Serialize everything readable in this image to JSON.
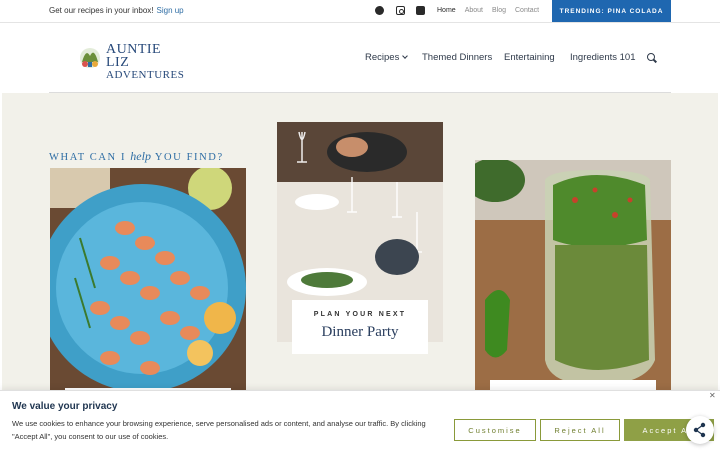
{
  "topbar": {
    "promo_text": "Get our recipes in your inbox!",
    "promo_link": "Sign up",
    "social": [
      "facebook-icon",
      "instagram-icon",
      "tiktok-icon"
    ],
    "links": [
      "Home",
      "About",
      "Blog",
      "Contact"
    ],
    "active_link": "Home",
    "trending": "TRENDING: PINA COLADA"
  },
  "header": {
    "logo_line1": "AUNTIE LIZ",
    "logo_line2": "ADVENTURES",
    "nav": [
      "Recipes",
      "Themed Dinners",
      "Entertaining",
      "Ingredients 101"
    ]
  },
  "main": {
    "find_pre": "WHAT CAN I",
    "find_script": "help",
    "find_post": "YOU FIND?",
    "cards": [
      {
        "kicker": "PLAN YOUR NEXT",
        "title": "Dinner Party"
      }
    ]
  },
  "cookie": {
    "title": "We value your privacy",
    "text": "We use cookies to enhance your browsing experience, serve personalised ads or content, and analyse our traffic. By clicking \"Accept All\", you consent to our use of cookies.",
    "customise": "Customise",
    "reject": "Reject All",
    "accept": "Accept All"
  },
  "colors": {
    "accent": "#1f67b0",
    "heading_blue": "#2e6da4",
    "cookie_green": "#8fa046",
    "content_bg": "#f2f1ea"
  }
}
